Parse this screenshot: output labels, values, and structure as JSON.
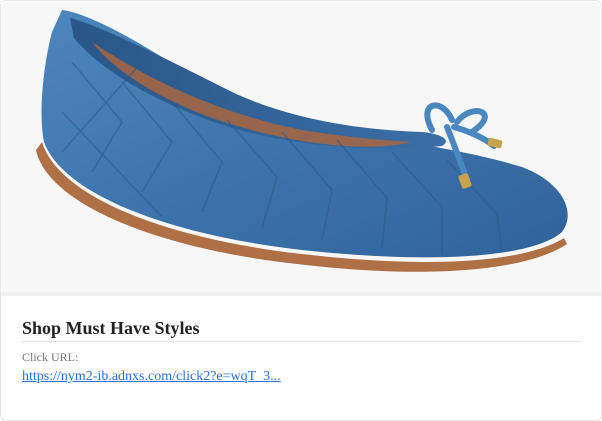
{
  "ad": {
    "title": "Shop Must Have Styles",
    "click_label": "Click URL:",
    "click_url": "https://nym2-ib.adnxs.com/click2?e=wqT_3..."
  },
  "product_image": {
    "subject": "blue denim quilted ballet flat",
    "colors": {
      "denim": "#3f77ad",
      "denim_dark": "#2f5f8f",
      "sole": "#b07046",
      "lining": "#2a5688",
      "tip": "#c9a24a"
    }
  },
  "colors": {
    "link": "#2a6fdb",
    "title": "#222222",
    "label": "#777777"
  }
}
